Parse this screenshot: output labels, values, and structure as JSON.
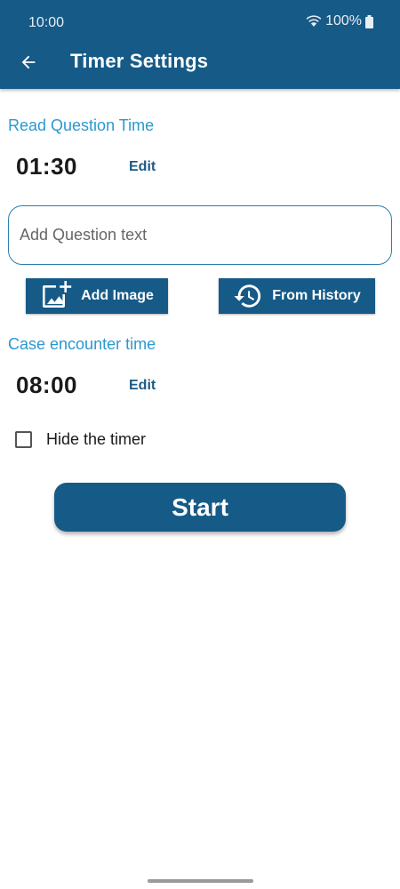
{
  "status_bar": {
    "time": "10:00",
    "battery": "100%"
  },
  "app_bar": {
    "title": "Timer Settings"
  },
  "read_question": {
    "label": "Read Question Time",
    "time": "01:30",
    "edit_label": "Edit"
  },
  "question_input": {
    "value": "",
    "placeholder": "Add Question text"
  },
  "buttons": {
    "add_image": "Add Image",
    "from_history": "From History",
    "start": "Start"
  },
  "case_encounter": {
    "label": "Case encounter time",
    "time": "08:00",
    "edit_label": "Edit"
  },
  "hide_timer": {
    "label": "Hide the timer",
    "checked": false
  },
  "colors": {
    "primary": "#165a87",
    "accent_label": "#2b98cf"
  }
}
